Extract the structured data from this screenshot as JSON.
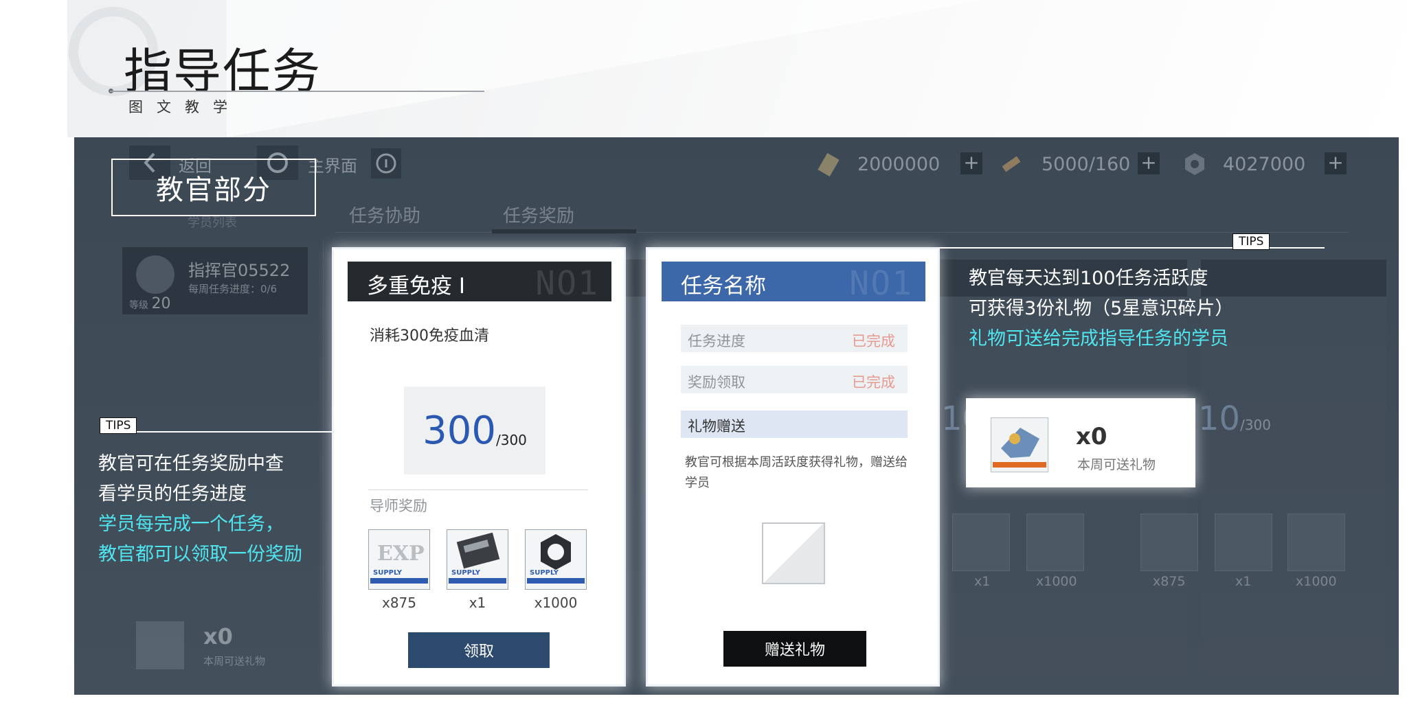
{
  "header": {
    "title": "指导任务",
    "subtitle": "图文教学"
  },
  "screen": {
    "section_label": "教官部分",
    "topbar": {
      "back_label": "返回",
      "home_label": "主界面",
      "resources": [
        {
          "icon": "ticket-icon",
          "value": "2000000"
        },
        {
          "icon": "syringe-icon",
          "value": "5000/160"
        },
        {
          "icon": "hex-nut-icon",
          "value": "4027000"
        }
      ]
    },
    "tabs": [
      "任务协助",
      "任务奖励"
    ],
    "student_list_label": "学员列表",
    "commander": {
      "name": "指挥官05522",
      "weekly_progress": "每周任务进度：0/6",
      "level_label": "等级",
      "level": "20"
    },
    "footer": {
      "count": "x0",
      "label": "本周可送礼物"
    },
    "background_cards": {
      "num_a": "10",
      "num_b": "10",
      "denominator": "/300",
      "qtys": [
        "x1",
        "x1000",
        "x875",
        "x1",
        "x1000"
      ]
    }
  },
  "task_card": {
    "title": "多重免疫 Ⅰ",
    "watermark": "NO1",
    "cost_text": "消耗300免疫血清",
    "progress_current": "300",
    "progress_total": "/300",
    "reward_label": "导师奖励",
    "rewards": [
      {
        "icon": "exp-icon",
        "qty": "x875"
      },
      {
        "icon": "card-icon",
        "qty": "x1"
      },
      {
        "icon": "hex-nut-icon",
        "qty": "x1000"
      }
    ],
    "supply_label": "SUPPLY",
    "claim_label": "领取"
  },
  "gift_card": {
    "title": "任务名称",
    "watermark": "NO1",
    "rows": [
      {
        "key": "任务进度",
        "value": "已完成"
      },
      {
        "key": "奖励领取",
        "value": "已完成"
      }
    ],
    "gift_heading": "礼物赠送",
    "gift_desc": "教官可根据本周活跃度获得礼物，赠送给学员",
    "send_label": "赠送礼物"
  },
  "gift_popup": {
    "count": "x0",
    "label": "本周可送礼物"
  },
  "tips_left": {
    "tag": "TIPS",
    "line1": "教官可在任务奖励中查",
    "line2": "看学员的任务进度",
    "line3": "学员每完成一个任务，",
    "line4": "教官都可以领取一份奖励"
  },
  "tips_right": {
    "tag": "TIPS",
    "line1": "教官每天达到100任务活跃度",
    "line2": "可获得3份礼物（5星意识碎片）",
    "line3": "礼物可送给完成指导任务的学员"
  },
  "colors": {
    "accent_cyan": "#4fe6f0",
    "progress_blue": "#2b58b0",
    "header_blue": "#3c67a8",
    "done_red": "#e79a8f",
    "screen_bg": "#3a4652"
  }
}
